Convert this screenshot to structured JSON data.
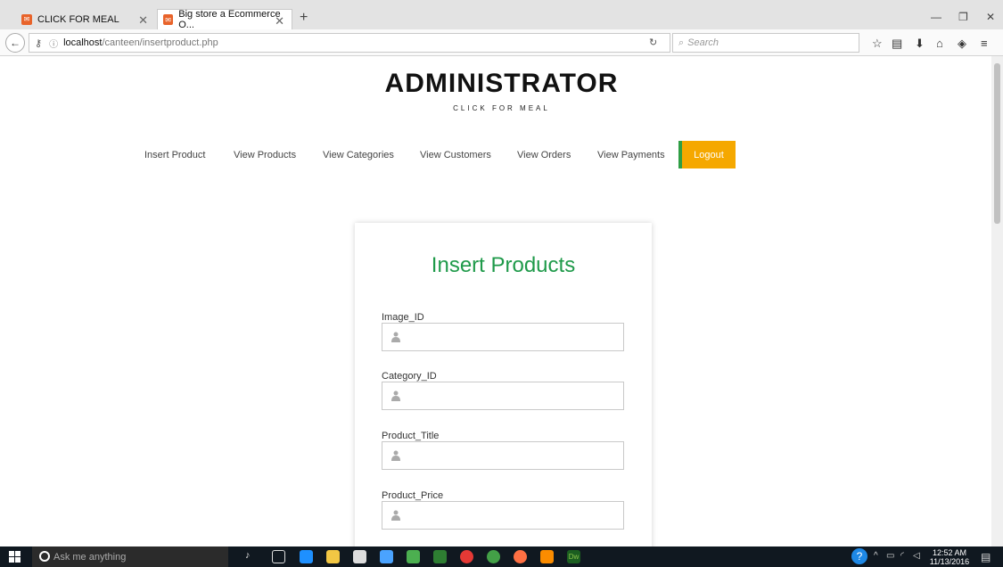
{
  "browser": {
    "tabs": [
      {
        "label": "CLICK FOR MEAL"
      },
      {
        "label": "Big store a Ecommerce O..."
      }
    ],
    "url_host": "localhost",
    "url_path": "/canteen/insertproduct.php",
    "search_placeholder": "Search"
  },
  "header": {
    "brand": "ADMINISTRATOR",
    "tagline": "CLICK FOR MEAL"
  },
  "menu": {
    "items": [
      "Insert Product",
      "View Products",
      "View Categories",
      "View Customers",
      "View Orders",
      "View Payments"
    ],
    "logout": "Logout"
  },
  "form": {
    "title": "Insert Products",
    "fields": [
      {
        "label": "Image_ID"
      },
      {
        "label": "Category_ID"
      },
      {
        "label": "Product_Title"
      },
      {
        "label": "Product_Price"
      }
    ]
  },
  "taskbar": {
    "search_placeholder": "Ask me anything",
    "time": "12:52 AM",
    "date": "11/13/2016"
  },
  "colors": {
    "accent_green": "#1f9a4a",
    "logout_bg": "#f5a800",
    "logout_border": "#2f9e44"
  }
}
